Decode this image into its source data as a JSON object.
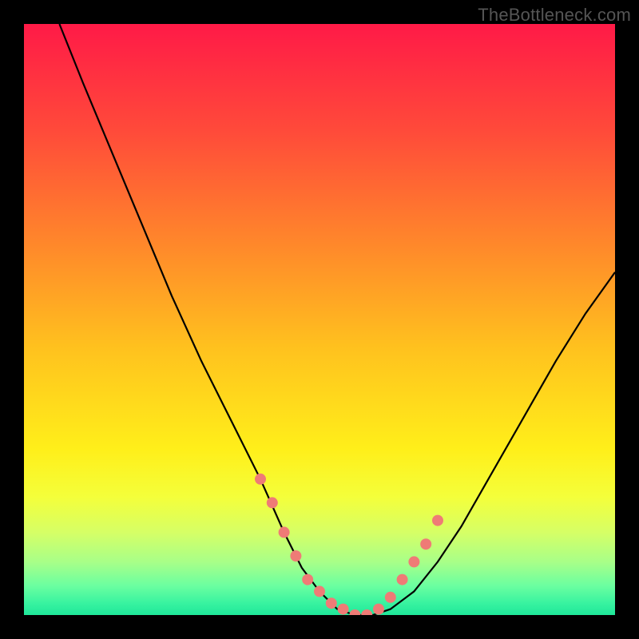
{
  "watermark": "TheBottleneck.com",
  "chart_data": {
    "type": "line",
    "title": "",
    "xlabel": "",
    "ylabel": "",
    "xlim": [
      0,
      100
    ],
    "ylim": [
      0,
      100
    ],
    "grid": false,
    "legend": false,
    "series": [
      {
        "name": "curve",
        "x": [
          6,
          10,
          15,
          20,
          25,
          30,
          35,
          40,
          44,
          47,
          50,
          53,
          56,
          59,
          62,
          66,
          70,
          74,
          78,
          82,
          86,
          90,
          95,
          100
        ],
        "y": [
          100,
          90,
          78,
          66,
          54,
          43,
          33,
          23,
          14,
          8,
          4,
          1,
          0,
          0,
          1,
          4,
          9,
          15,
          22,
          29,
          36,
          43,
          51,
          58
        ],
        "color": "#000000"
      }
    ],
    "markers": {
      "name": "dots",
      "x": [
        40,
        42,
        44,
        46,
        48,
        50,
        52,
        54,
        56,
        58,
        60,
        62,
        64,
        66,
        68,
        70
      ],
      "y": [
        23,
        19,
        14,
        10,
        6,
        4,
        2,
        1,
        0,
        0,
        1,
        3,
        6,
        9,
        12,
        16
      ],
      "color": "#ef7b76",
      "radius": 7
    },
    "gradient_stops": [
      {
        "offset": 0,
        "color": "#ff1a47"
      },
      {
        "offset": 18,
        "color": "#ff4a3a"
      },
      {
        "offset": 38,
        "color": "#ff8a2a"
      },
      {
        "offset": 55,
        "color": "#ffc21e"
      },
      {
        "offset": 72,
        "color": "#ffef1a"
      },
      {
        "offset": 80,
        "color": "#f4ff3a"
      },
      {
        "offset": 86,
        "color": "#d6ff66"
      },
      {
        "offset": 91,
        "color": "#a8ff88"
      },
      {
        "offset": 95,
        "color": "#6cffa0"
      },
      {
        "offset": 98,
        "color": "#38f3a0"
      },
      {
        "offset": 100,
        "color": "#1fe79a"
      }
    ]
  }
}
